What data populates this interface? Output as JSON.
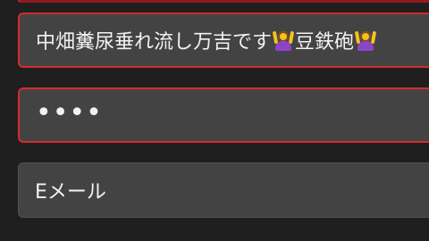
{
  "fields": {
    "username": {
      "value_part1": "中畑糞尿垂れ流し万吉です",
      "value_part2": "豆鉄砲",
      "emoji_1": "woman-gesturing-ok-icon",
      "emoji_2": "woman-gesturing-ok-icon",
      "state": "error"
    },
    "password": {
      "value": "••••",
      "state": "error"
    },
    "email": {
      "placeholder": "Eメール",
      "state": "normal"
    }
  },
  "colors": {
    "background": "#1f1f1f",
    "field_bg": "#434343",
    "error_border": "#d62b2b",
    "text": "#f2f2f2"
  }
}
